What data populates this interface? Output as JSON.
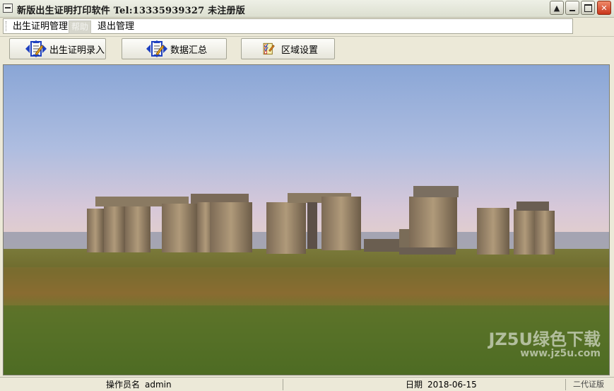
{
  "window": {
    "title": "新版出生证明打印软件   Tel:13335939327 未注册版"
  },
  "menu": {
    "items": [
      {
        "label": "出生证明管理",
        "enabled": true
      },
      {
        "label": "帮助",
        "enabled": false
      },
      {
        "label": "退出管理",
        "enabled": true
      }
    ]
  },
  "toolbar": {
    "birth_entry_label": "出生证明录入",
    "data_summary_label": "数据汇总",
    "region_settings_label": "区域设置"
  },
  "watermark": {
    "line1": "JZ5U绿色下载",
    "line2": "www.jz5u.com"
  },
  "status": {
    "operator_label": "操作员名",
    "operator_value": "admin",
    "date_label": "日期",
    "date_value": "2018-06-15",
    "corner_text": "二代证版"
  }
}
